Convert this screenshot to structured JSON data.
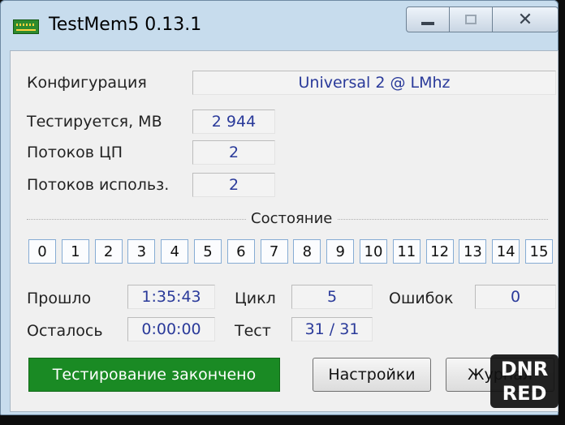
{
  "window": {
    "title": "TestMem5  0.13.1",
    "icon": "ram-chip-icon",
    "controls": {
      "minimize": "minimize-icon",
      "maximize": "maximize-icon",
      "close": "✕"
    }
  },
  "config": {
    "configuration_label": "Конфигурация",
    "configuration_value": "Universal 2 @ LMhz",
    "tested_label": "Тестируется, MB",
    "tested_value": "2 944",
    "cpu_threads_label": "Потоков ЦП",
    "cpu_threads_value": "2",
    "used_threads_label": "Потоков использ.",
    "used_threads_value": "2"
  },
  "state": {
    "title": "Состояние",
    "threads": [
      "0",
      "1",
      "2",
      "3",
      "4",
      "5",
      "6",
      "7",
      "8",
      "9",
      "10",
      "11",
      "12",
      "13",
      "14",
      "15"
    ]
  },
  "stats": {
    "elapsed_label": "Прошло",
    "elapsed_value": "1:35:43",
    "remaining_label": "Осталось",
    "remaining_value": "0:00:00",
    "cycle_label": "Цикл",
    "cycle_value": "5",
    "test_label": "Тест",
    "test_value": "31 / 31",
    "errors_label": "Ошибок",
    "errors_value": "0"
  },
  "footer": {
    "status": "Тестирование закончено",
    "settings_button": "Настройки",
    "log_button": "Журнал"
  },
  "watermark": {
    "line1": "DNR",
    "line2": "RED"
  },
  "colors": {
    "status_bg": "#1a8a24",
    "value_text": "#2a3a9a",
    "thread_border": "#86acd4"
  }
}
